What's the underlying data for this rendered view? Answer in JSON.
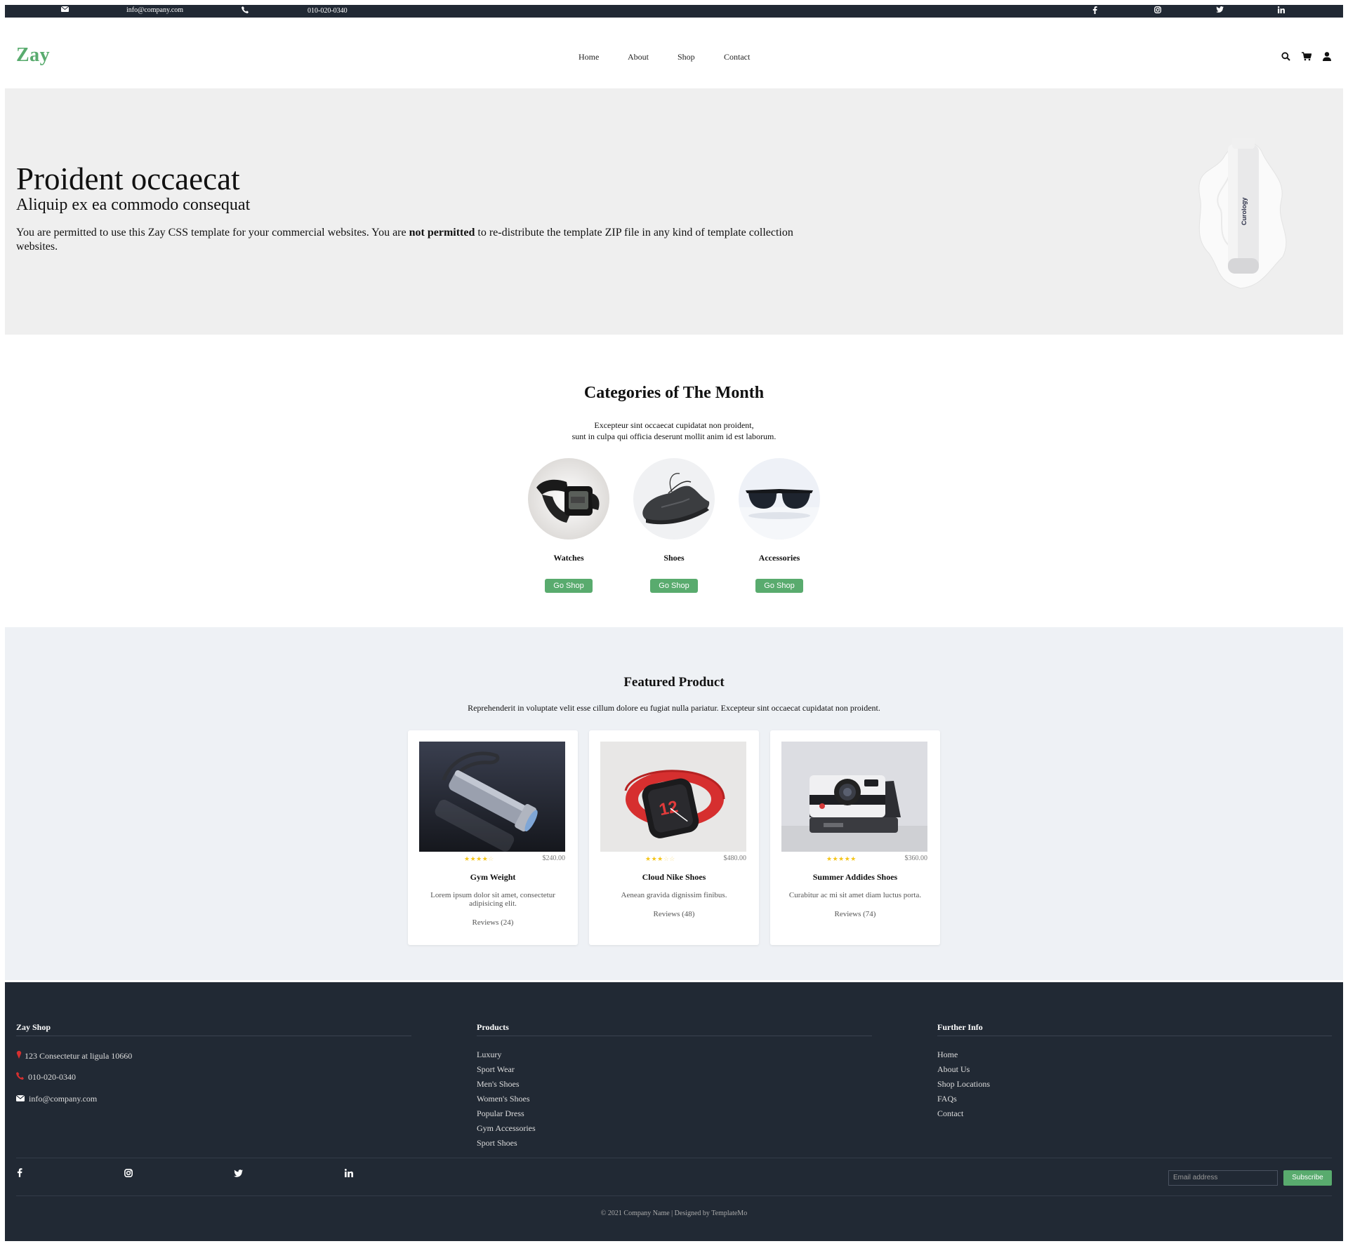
{
  "topbar": {
    "email": "info@company.com",
    "phone": "010-020-0340",
    "social": [
      "facebook-icon",
      "instagram-icon",
      "twitter-icon",
      "linkedin-icon"
    ]
  },
  "header": {
    "logo": "Zay",
    "nav": [
      "Home",
      "About",
      "Shop",
      "Contact"
    ],
    "icons": [
      "search-icon",
      "cart-icon",
      "user-icon"
    ]
  },
  "hero": {
    "title": "Proident occaecat",
    "subtitle": "Aliquip ex ea commodo consequat",
    "text_before": "You are permitted to use this Zay CSS template for your commercial websites. You are ",
    "text_bold": "not permitted",
    "text_after": " to re-distribute the template ZIP file in any kind of template collection websites.",
    "image_label": "Curology"
  },
  "categories": {
    "title": "Categories of The Month",
    "desc_line1": "Excepteur sint occaecat cupidatat non proident,",
    "desc_line2": "sunt in culpa qui officia deserunt mollit anim id est laborum.",
    "items": [
      {
        "name": "Watches",
        "button": "Go Shop"
      },
      {
        "name": "Shoes",
        "button": "Go Shop"
      },
      {
        "name": "Accessories",
        "button": "Go Shop"
      }
    ]
  },
  "featured": {
    "title": "Featured Product",
    "desc": "Reprehenderit in voluptate velit esse cillum dolore eu fugiat nulla pariatur. Excepteur sint occaecat cupidatat non proident.",
    "products": [
      {
        "name": "Gym Weight",
        "price": "$240.00",
        "rating": 4,
        "desc": "Lorem ipsum dolor sit amet, consectetur adipisicing elit.",
        "reviews": "Reviews (24)"
      },
      {
        "name": "Cloud Nike Shoes",
        "price": "$480.00",
        "rating": 3,
        "desc": "Aenean gravida dignissim finibus.",
        "reviews": "Reviews (48)"
      },
      {
        "name": "Summer Addides Shoes",
        "price": "$360.00",
        "rating": 5,
        "desc": "Curabitur ac mi sit amet diam luctus porta.",
        "reviews": "Reviews (74)"
      }
    ]
  },
  "footer": {
    "col1": {
      "title": "Zay Shop",
      "address": "123 Consectetur at ligula 10660",
      "phone": "010-020-0340",
      "email": "info@company.com"
    },
    "col2": {
      "title": "Products",
      "links": [
        "Luxury",
        "Sport Wear",
        "Men's Shoes",
        "Women's Shoes",
        "Popular Dress",
        "Gym Accessories",
        "Sport Shoes"
      ]
    },
    "col3": {
      "title": "Further Info",
      "links": [
        "Home",
        "About Us",
        "Shop Locations",
        "FAQs",
        "Contact"
      ]
    },
    "email_placeholder": "Email address",
    "subscribe": "Subscribe",
    "copyright": "© 2021 Company Name | Designed by TemplateMo"
  },
  "colors": {
    "accent": "#59ab6e",
    "dark": "#212934",
    "star": "#f5c518"
  }
}
